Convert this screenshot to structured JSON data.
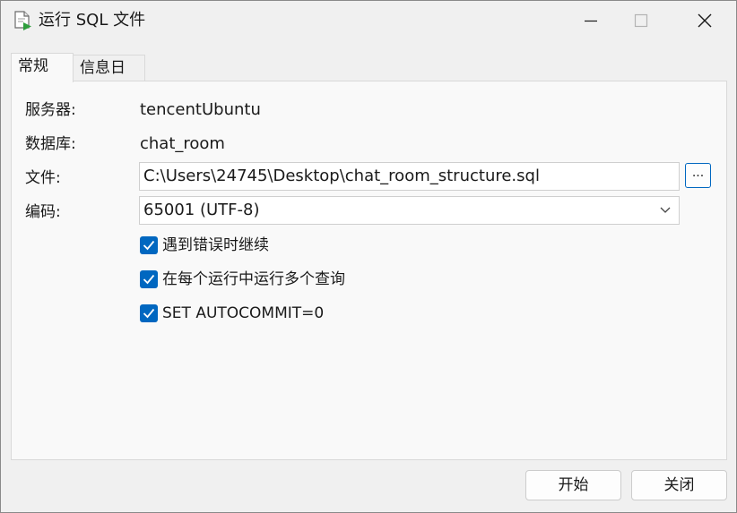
{
  "window": {
    "title": "运行 SQL 文件",
    "icons": {
      "app": "sql-file-run-icon",
      "minimize": "minimize-icon",
      "maximize": "maximize-icon",
      "close": "close-icon"
    }
  },
  "tabs": [
    {
      "label": "常规",
      "selected": true
    },
    {
      "label": "信息日志",
      "selected": false
    }
  ],
  "form": {
    "server": {
      "label": "服务器:",
      "value": "tencentUbuntu"
    },
    "database": {
      "label": "数据库:",
      "value": "chat_room"
    },
    "file": {
      "label": "文件:",
      "value": "C:\\Users\\24745\\Desktop\\chat_room_structure.sql",
      "browse_label": "..."
    },
    "encoding": {
      "label": "编码:",
      "value": "65001 (UTF-8)"
    }
  },
  "options": [
    {
      "label": "遇到错误时继续",
      "checked": true
    },
    {
      "label": "在每个运行中运行多个查询",
      "checked": true
    },
    {
      "label": "SET AUTOCOMMIT=0",
      "checked": true
    }
  ],
  "footer": {
    "start_label": "开始",
    "close_label": "关闭"
  },
  "colors": {
    "accent": "#0067c0",
    "window_bg": "#f0f0f0",
    "panel_bg": "#f9f9f9"
  }
}
